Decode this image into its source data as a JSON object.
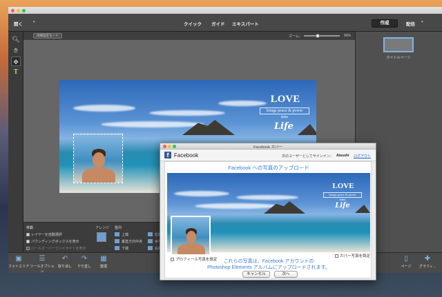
{
  "app": {
    "open_label": "開く",
    "modes": [
      "クイック",
      "ガイド",
      "エキスパート"
    ],
    "create_label": "作成",
    "share_label": "配信",
    "info_label": "詳細設定モード",
    "zoom_label": "ズーム：",
    "zoom_value": "96%",
    "zoom_fraction": 0.38,
    "title_page_label": "タイトルページ"
  },
  "cover": {
    "love": "LOVE",
    "brings": "brings peace & power",
    "into": "into",
    "life": "Life"
  },
  "options": {
    "move_label": "移動",
    "auto_select": "レイヤーを自動選択",
    "show_bbox": "バウンディングボックスを表示",
    "highlight": "ロールオーバーでハイライトを表示",
    "arrange_label": "アレンジ",
    "align_label": "整列",
    "align_items": [
      "上端",
      "垂直方向中央",
      "下端"
    ],
    "align_items_2": [
      "左端",
      "水平方向",
      "右端"
    ]
  },
  "bottom": {
    "photo_bin": "フォトエリア",
    "tool_options": "ツールオプション",
    "undo": "取り消し",
    "redo": "やり直し",
    "organizer": "整理",
    "pages": "ページ",
    "graphics": "グラフィ..."
  },
  "dialog": {
    "window_title": "Facebook カバー",
    "brand": "Facebook",
    "signed_in_as": "次のユーザーとしてサインイン：",
    "user_name": "Atsushi",
    "logout": "ログアウト",
    "heading": "Facebook への写真のアップロード",
    "profile_checkbox": "プロフィール写真を設定",
    "cover_checkbox": "カバー写真を設定",
    "message_line1": "これらの写真は、Facebook アカウントの",
    "message_line2": "Photoshop Elements アルバムにアップロードされます。",
    "cancel": "キャンセル",
    "next": "次へ"
  },
  "colors": {
    "facebook_blue": "#3b5998",
    "accent_blue": "#3a7bd5",
    "link_blue": "#1a5fd0"
  }
}
